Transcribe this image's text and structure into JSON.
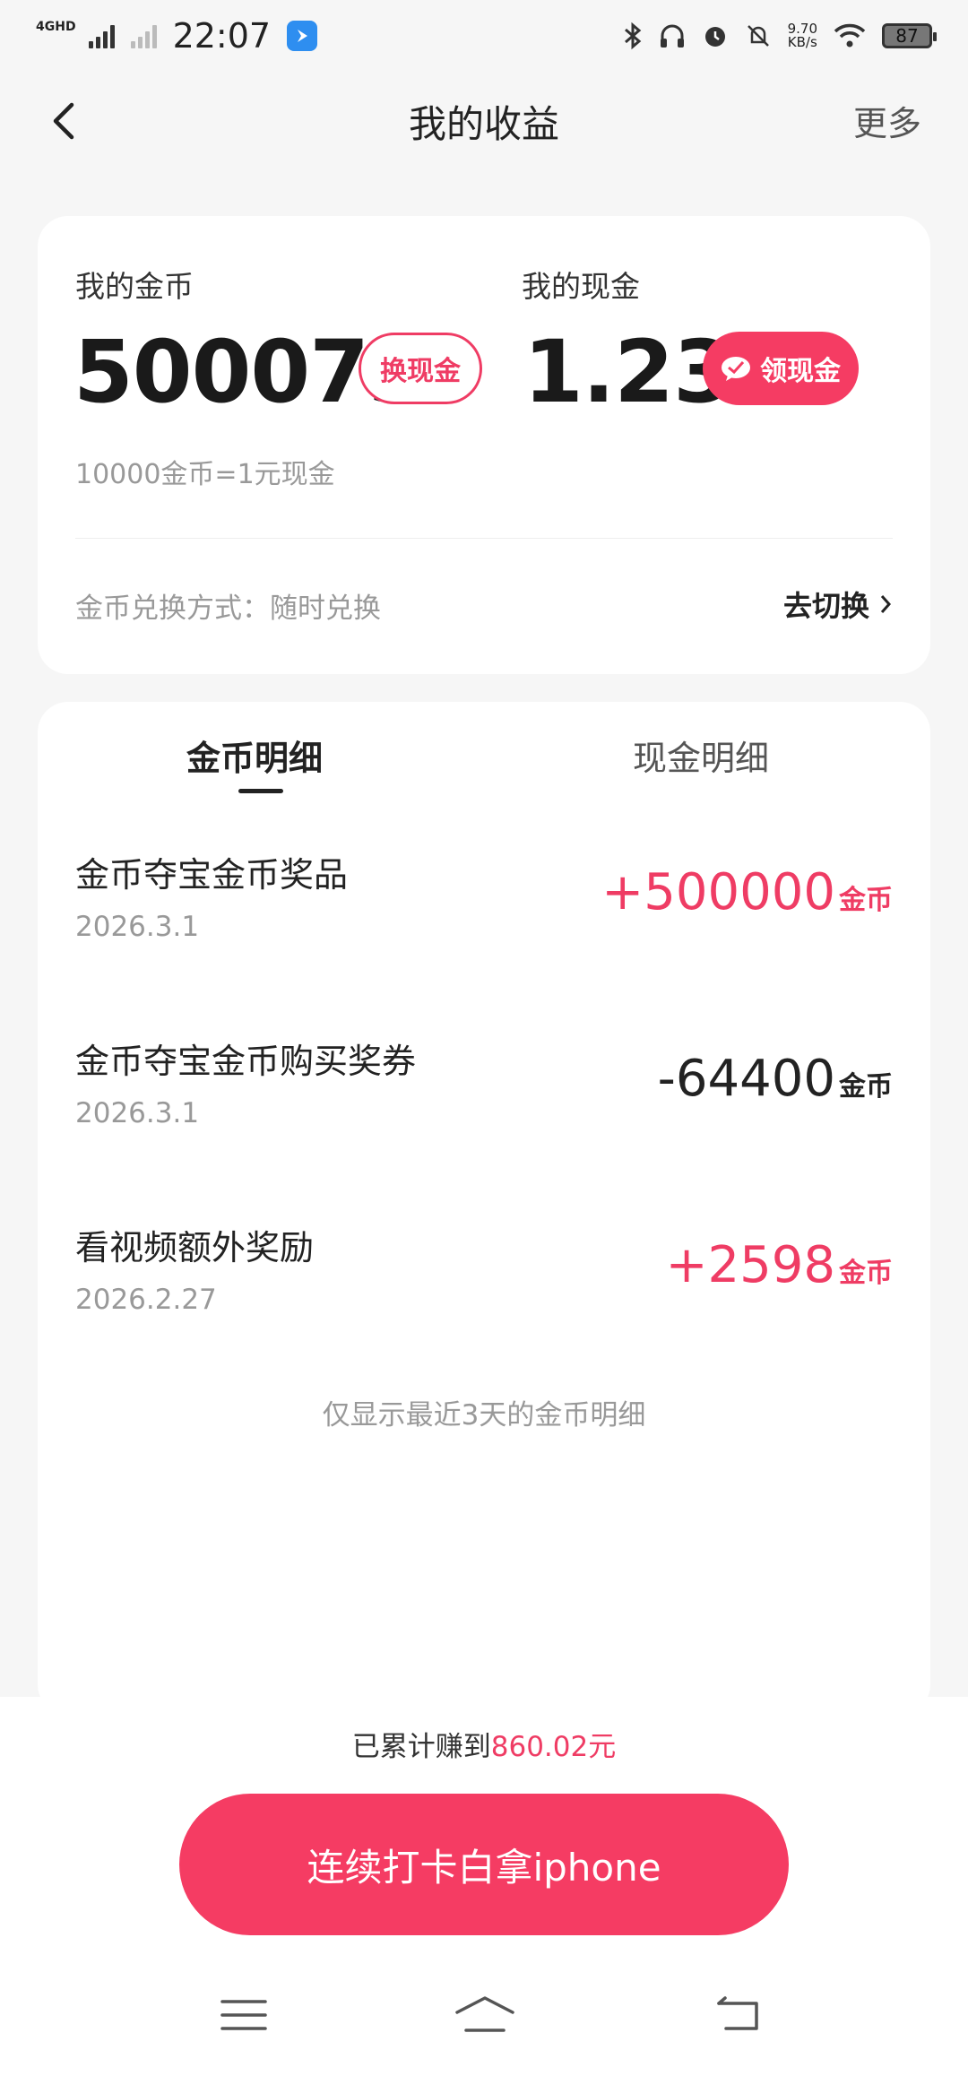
{
  "status": {
    "network": "4GHD",
    "time": "22:07",
    "speed_value": "9.70",
    "speed_unit": "KB/s",
    "battery": "87"
  },
  "nav": {
    "title": "我的收益",
    "more": "更多"
  },
  "summary": {
    "coins_label": "我的金币",
    "coins_value": "500073",
    "exchange_button": "换现金",
    "cash_label": "我的现金",
    "cash_value": "1.23",
    "withdraw_button": "领现金",
    "rate": "10000金币=1元现金",
    "exchange_mode": "金币兑换方式：随时兑换",
    "switch_label": "去切换"
  },
  "tabs": [
    {
      "label": "金币明细",
      "active": true
    },
    {
      "label": "现金明细",
      "active": false
    }
  ],
  "records": [
    {
      "title": "金币夺宝金币奖品",
      "date": "2026.3.1",
      "amount": "+500000",
      "unit": "金币",
      "positive": true
    },
    {
      "title": "金币夺宝金币购买奖券",
      "date": "2026.3.1",
      "amount": "-64400",
      "unit": "金币",
      "positive": false
    },
    {
      "title": "看视频额外奖励",
      "date": "2026.2.27",
      "amount": "+2598",
      "unit": "金币",
      "positive": true
    }
  ],
  "records_note": "仅显示最近3天的金币明细",
  "footer": {
    "earned_prefix": "已累计赚到",
    "earned_amount": "860.02元",
    "cta": "连续打卡白拿iphone"
  },
  "colors": {
    "accent": "#f53c63",
    "accent_text": "#ef3c64",
    "background": "#f6f6f6"
  }
}
